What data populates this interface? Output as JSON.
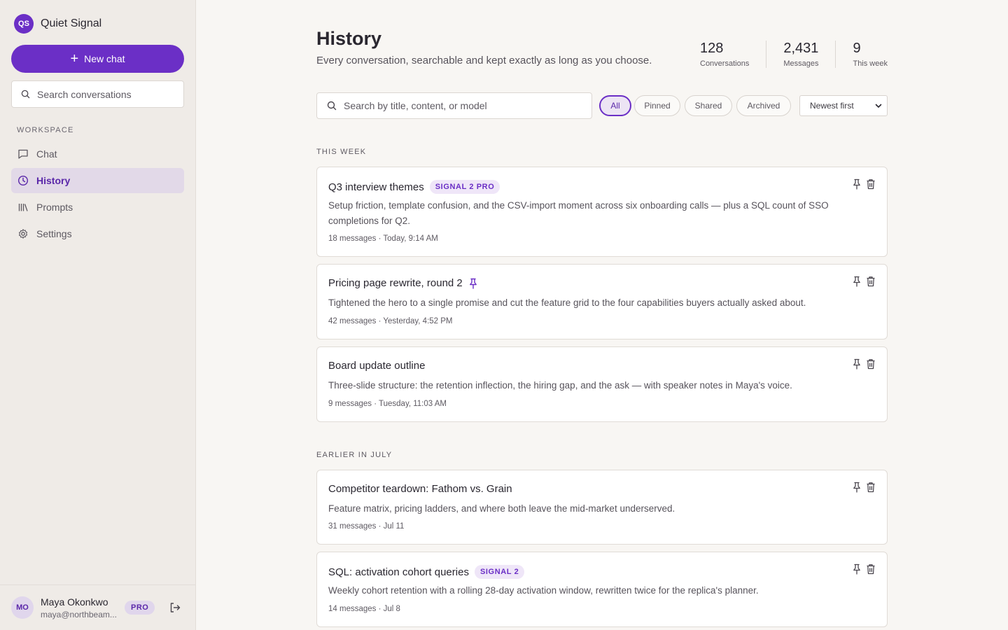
{
  "brand": {
    "initials": "QS",
    "name": "Quiet Signal"
  },
  "sidebar": {
    "new_chat_label": "New chat",
    "search_placeholder": "Search conversations",
    "section_label": "WORKSPACE",
    "items": [
      {
        "label": "Chat",
        "icon": "chat-bubble-icon",
        "active": false
      },
      {
        "label": "History",
        "icon": "clock-icon",
        "active": true
      },
      {
        "label": "Prompts",
        "icon": "library-icon",
        "active": false
      },
      {
        "label": "Settings",
        "icon": "gear-icon",
        "active": false
      }
    ]
  },
  "user": {
    "initials": "MO",
    "name": "Maya Okonkwo",
    "email": "maya@northbeam...",
    "plan": "PRO"
  },
  "header": {
    "title": "History",
    "subtitle": "Every conversation, searchable and kept exactly as long as you choose."
  },
  "stats": [
    {
      "value": "128",
      "label": "Conversations"
    },
    {
      "value": "2,431",
      "label": "Messages"
    },
    {
      "value": "9",
      "label": "This week"
    }
  ],
  "search": {
    "placeholder": "Search by title, content, or model"
  },
  "filters": [
    {
      "label": "All",
      "active": true
    },
    {
      "label": "Pinned",
      "active": false
    },
    {
      "label": "Shared",
      "active": false
    },
    {
      "label": "Archived",
      "active": false
    }
  ],
  "sort": {
    "selected": "Newest first"
  },
  "sections": [
    {
      "label": "THIS WEEK",
      "conversations": [
        {
          "title": "Q3 interview themes",
          "tag": "SIGNAL 2 PRO",
          "pinned": false,
          "description": "Setup friction, template confusion, and the CSV-import moment across six onboarding calls — plus a SQL count of SSO completions for Q2.",
          "meta": "18 messages · Today, 9:14 AM"
        },
        {
          "title": "Pricing page rewrite, round 2",
          "tag": "",
          "pinned": true,
          "description": "Tightened the hero to a single promise and cut the feature grid to the four capabilities buyers actually asked about.",
          "meta": "42 messages · Yesterday, 4:52 PM"
        },
        {
          "title": "Board update outline",
          "tag": "",
          "pinned": false,
          "description": "Three-slide structure: the retention inflection, the hiring gap, and the ask — with speaker notes in Maya's voice.",
          "meta": "9 messages · Tuesday, 11:03 AM"
        }
      ]
    },
    {
      "label": "EARLIER IN JULY",
      "conversations": [
        {
          "title": "Competitor teardown: Fathom vs. Grain",
          "tag": "",
          "pinned": false,
          "description": "Feature matrix, pricing ladders, and where both leave the mid-market underserved.",
          "meta": "31 messages · Jul 11"
        },
        {
          "title": "SQL: activation cohort queries",
          "tag": "SIGNAL 2",
          "pinned": false,
          "description": "Weekly cohort retention with a rolling 28-day activation window, rewritten twice for the replica's planner.",
          "meta": "14 messages · Jul 8"
        }
      ]
    }
  ],
  "colors": {
    "accent": "#6b2fc6",
    "sidebar_bg": "#efebe7",
    "page_bg": "#f8f6f3"
  }
}
